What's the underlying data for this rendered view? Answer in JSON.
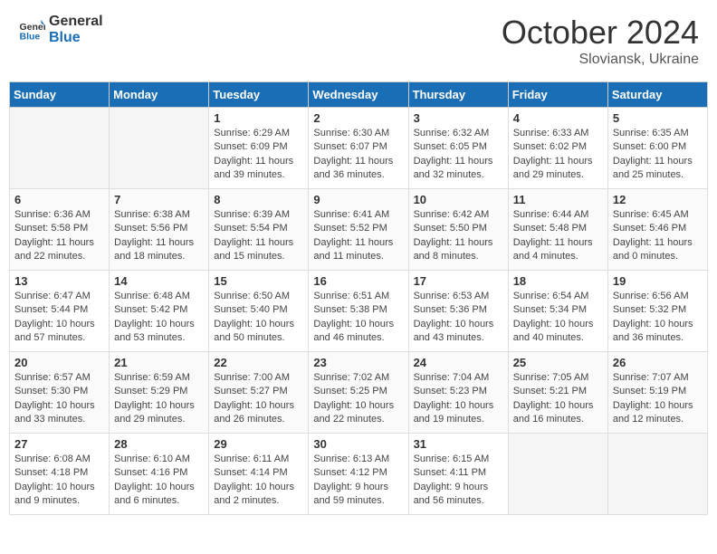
{
  "header": {
    "logo_general": "General",
    "logo_blue": "Blue",
    "month_title": "October 2024",
    "location": "Sloviansk, Ukraine"
  },
  "days_of_week": [
    "Sunday",
    "Monday",
    "Tuesday",
    "Wednesday",
    "Thursday",
    "Friday",
    "Saturday"
  ],
  "weeks": [
    [
      {
        "day": "",
        "empty": true
      },
      {
        "day": "",
        "empty": true
      },
      {
        "day": "1",
        "sunrise": "Sunrise: 6:29 AM",
        "sunset": "Sunset: 6:09 PM",
        "daylight": "Daylight: 11 hours and 39 minutes."
      },
      {
        "day": "2",
        "sunrise": "Sunrise: 6:30 AM",
        "sunset": "Sunset: 6:07 PM",
        "daylight": "Daylight: 11 hours and 36 minutes."
      },
      {
        "day": "3",
        "sunrise": "Sunrise: 6:32 AM",
        "sunset": "Sunset: 6:05 PM",
        "daylight": "Daylight: 11 hours and 32 minutes."
      },
      {
        "day": "4",
        "sunrise": "Sunrise: 6:33 AM",
        "sunset": "Sunset: 6:02 PM",
        "daylight": "Daylight: 11 hours and 29 minutes."
      },
      {
        "day": "5",
        "sunrise": "Sunrise: 6:35 AM",
        "sunset": "Sunset: 6:00 PM",
        "daylight": "Daylight: 11 hours and 25 minutes."
      }
    ],
    [
      {
        "day": "6",
        "sunrise": "Sunrise: 6:36 AM",
        "sunset": "Sunset: 5:58 PM",
        "daylight": "Daylight: 11 hours and 22 minutes."
      },
      {
        "day": "7",
        "sunrise": "Sunrise: 6:38 AM",
        "sunset": "Sunset: 5:56 PM",
        "daylight": "Daylight: 11 hours and 18 minutes."
      },
      {
        "day": "8",
        "sunrise": "Sunrise: 6:39 AM",
        "sunset": "Sunset: 5:54 PM",
        "daylight": "Daylight: 11 hours and 15 minutes."
      },
      {
        "day": "9",
        "sunrise": "Sunrise: 6:41 AM",
        "sunset": "Sunset: 5:52 PM",
        "daylight": "Daylight: 11 hours and 11 minutes."
      },
      {
        "day": "10",
        "sunrise": "Sunrise: 6:42 AM",
        "sunset": "Sunset: 5:50 PM",
        "daylight": "Daylight: 11 hours and 8 minutes."
      },
      {
        "day": "11",
        "sunrise": "Sunrise: 6:44 AM",
        "sunset": "Sunset: 5:48 PM",
        "daylight": "Daylight: 11 hours and 4 minutes."
      },
      {
        "day": "12",
        "sunrise": "Sunrise: 6:45 AM",
        "sunset": "Sunset: 5:46 PM",
        "daylight": "Daylight: 11 hours and 0 minutes."
      }
    ],
    [
      {
        "day": "13",
        "sunrise": "Sunrise: 6:47 AM",
        "sunset": "Sunset: 5:44 PM",
        "daylight": "Daylight: 10 hours and 57 minutes."
      },
      {
        "day": "14",
        "sunrise": "Sunrise: 6:48 AM",
        "sunset": "Sunset: 5:42 PM",
        "daylight": "Daylight: 10 hours and 53 minutes."
      },
      {
        "day": "15",
        "sunrise": "Sunrise: 6:50 AM",
        "sunset": "Sunset: 5:40 PM",
        "daylight": "Daylight: 10 hours and 50 minutes."
      },
      {
        "day": "16",
        "sunrise": "Sunrise: 6:51 AM",
        "sunset": "Sunset: 5:38 PM",
        "daylight": "Daylight: 10 hours and 46 minutes."
      },
      {
        "day": "17",
        "sunrise": "Sunrise: 6:53 AM",
        "sunset": "Sunset: 5:36 PM",
        "daylight": "Daylight: 10 hours and 43 minutes."
      },
      {
        "day": "18",
        "sunrise": "Sunrise: 6:54 AM",
        "sunset": "Sunset: 5:34 PM",
        "daylight": "Daylight: 10 hours and 40 minutes."
      },
      {
        "day": "19",
        "sunrise": "Sunrise: 6:56 AM",
        "sunset": "Sunset: 5:32 PM",
        "daylight": "Daylight: 10 hours and 36 minutes."
      }
    ],
    [
      {
        "day": "20",
        "sunrise": "Sunrise: 6:57 AM",
        "sunset": "Sunset: 5:30 PM",
        "daylight": "Daylight: 10 hours and 33 minutes."
      },
      {
        "day": "21",
        "sunrise": "Sunrise: 6:59 AM",
        "sunset": "Sunset: 5:29 PM",
        "daylight": "Daylight: 10 hours and 29 minutes."
      },
      {
        "day": "22",
        "sunrise": "Sunrise: 7:00 AM",
        "sunset": "Sunset: 5:27 PM",
        "daylight": "Daylight: 10 hours and 26 minutes."
      },
      {
        "day": "23",
        "sunrise": "Sunrise: 7:02 AM",
        "sunset": "Sunset: 5:25 PM",
        "daylight": "Daylight: 10 hours and 22 minutes."
      },
      {
        "day": "24",
        "sunrise": "Sunrise: 7:04 AM",
        "sunset": "Sunset: 5:23 PM",
        "daylight": "Daylight: 10 hours and 19 minutes."
      },
      {
        "day": "25",
        "sunrise": "Sunrise: 7:05 AM",
        "sunset": "Sunset: 5:21 PM",
        "daylight": "Daylight: 10 hours and 16 minutes."
      },
      {
        "day": "26",
        "sunrise": "Sunrise: 7:07 AM",
        "sunset": "Sunset: 5:19 PM",
        "daylight": "Daylight: 10 hours and 12 minutes."
      }
    ],
    [
      {
        "day": "27",
        "sunrise": "Sunrise: 6:08 AM",
        "sunset": "Sunset: 4:18 PM",
        "daylight": "Daylight: 10 hours and 9 minutes."
      },
      {
        "day": "28",
        "sunrise": "Sunrise: 6:10 AM",
        "sunset": "Sunset: 4:16 PM",
        "daylight": "Daylight: 10 hours and 6 minutes."
      },
      {
        "day": "29",
        "sunrise": "Sunrise: 6:11 AM",
        "sunset": "Sunset: 4:14 PM",
        "daylight": "Daylight: 10 hours and 2 minutes."
      },
      {
        "day": "30",
        "sunrise": "Sunrise: 6:13 AM",
        "sunset": "Sunset: 4:12 PM",
        "daylight": "Daylight: 9 hours and 59 minutes."
      },
      {
        "day": "31",
        "sunrise": "Sunrise: 6:15 AM",
        "sunset": "Sunset: 4:11 PM",
        "daylight": "Daylight: 9 hours and 56 minutes."
      },
      {
        "day": "",
        "empty": true
      },
      {
        "day": "",
        "empty": true
      }
    ]
  ]
}
